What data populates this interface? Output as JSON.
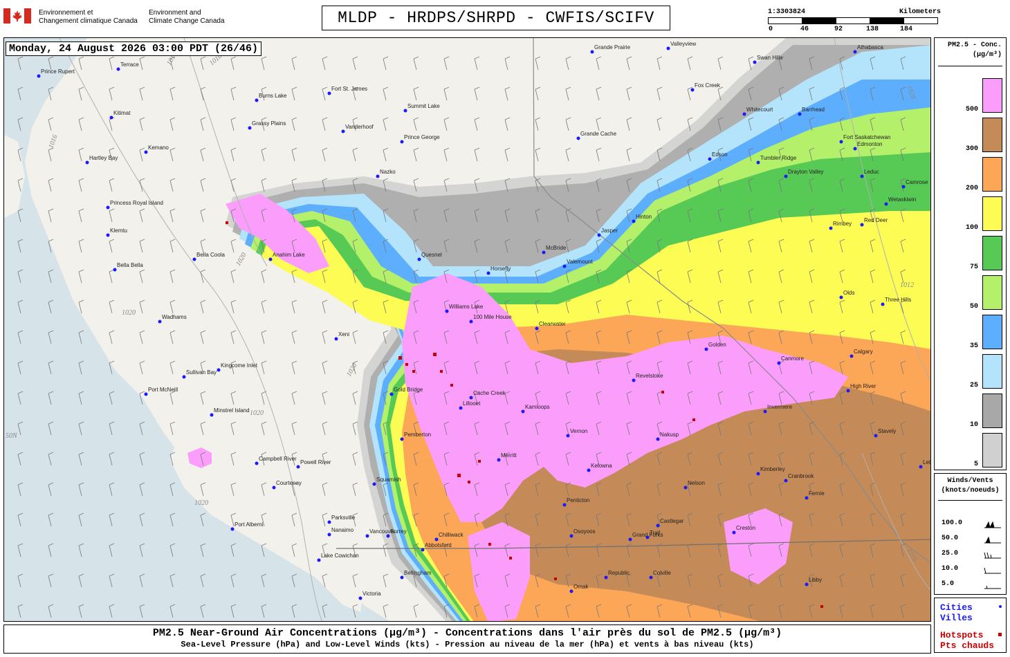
{
  "header": {
    "agency_fr_line1": "Environnement et",
    "agency_fr_line2": "Changement climatique Canada",
    "agency_en_line1": "Environment and",
    "agency_en_line2": "Climate Change Canada",
    "title": "MLDP - HRDPS/SHRPD - CWFIS/SCIFV"
  },
  "scale": {
    "ratio": "1:3303824",
    "unit_label": "Kilometers",
    "ticks": [
      "0",
      "46",
      "92",
      "138",
      "184"
    ]
  },
  "map": {
    "timestamp": "Monday, 24 August 2026 03:00 PDT (26/46)",
    "colors": {
      "water": "#d6e4ea",
      "land": "#f2f1ec",
      "city_dot": "#1a1aff",
      "hotspot": "#cc0000"
    },
    "isobar_labels": [
      "1016",
      "1016",
      "1016",
      "1020",
      "1020",
      "1020",
      "1020",
      "1020",
      "1012",
      "1016",
      "1028"
    ],
    "lat_label": "50N",
    "cities": [
      {
        "name": "Prince Rupert"
      },
      {
        "name": "Terrace"
      },
      {
        "name": "Kitimat"
      },
      {
        "name": "Hartley Bay"
      },
      {
        "name": "Kemano"
      },
      {
        "name": "Princess Royal Island"
      },
      {
        "name": "Klemtu"
      },
      {
        "name": "Bella Bella"
      },
      {
        "name": "Bella Coola"
      },
      {
        "name": "Anahim Lake"
      },
      {
        "name": "Wadhams"
      },
      {
        "name": "Sullivan Bay"
      },
      {
        "name": "Kingcome Inlet"
      },
      {
        "name": "Port McNeill"
      },
      {
        "name": "Minstrel Island"
      },
      {
        "name": "Campbell River"
      },
      {
        "name": "Powell River"
      },
      {
        "name": "Courtenay"
      },
      {
        "name": "Port Alberni"
      },
      {
        "name": "Parksville"
      },
      {
        "name": "Nanaimo"
      },
      {
        "name": "Lake Cowichan"
      },
      {
        "name": "Victoria"
      },
      {
        "name": "Squamish"
      },
      {
        "name": "Vancouver"
      },
      {
        "name": "Surrey"
      },
      {
        "name": "Abbotsford"
      },
      {
        "name": "Chilliwack"
      },
      {
        "name": "Bellingham"
      },
      {
        "name": "Burns Lake"
      },
      {
        "name": "Grassy Plains"
      },
      {
        "name": "Fort St. James"
      },
      {
        "name": "Vanderhoof"
      },
      {
        "name": "Prince George"
      },
      {
        "name": "Summit Lake"
      },
      {
        "name": "Grande Cache"
      },
      {
        "name": "Grande Prairie"
      },
      {
        "name": "Valleyview"
      },
      {
        "name": "Fox Creek"
      },
      {
        "name": "Swan Hills"
      },
      {
        "name": "Whitecourt"
      },
      {
        "name": "Edson"
      },
      {
        "name": "Drayton Valley"
      },
      {
        "name": "Barrhead"
      },
      {
        "name": "Fort Saskatchewan"
      },
      {
        "name": "Edmonton"
      },
      {
        "name": "Leduc"
      },
      {
        "name": "Wetaskiwin"
      },
      {
        "name": "Camrose"
      },
      {
        "name": "Rimbey"
      },
      {
        "name": "Red Deer"
      },
      {
        "name": "Olds"
      },
      {
        "name": "Three Hills"
      },
      {
        "name": "Calgary"
      },
      {
        "name": "Canmore"
      },
      {
        "name": "High River"
      },
      {
        "name": "Stavely"
      },
      {
        "name": "Lethbridge"
      },
      {
        "name": "Fernie"
      },
      {
        "name": "Cranbrook"
      },
      {
        "name": "Kimberley"
      },
      {
        "name": "Invermere"
      },
      {
        "name": "Golden"
      },
      {
        "name": "Revelstoke"
      },
      {
        "name": "Nakusp"
      },
      {
        "name": "Nelson"
      },
      {
        "name": "Castlegar"
      },
      {
        "name": "Trail"
      },
      {
        "name": "Creston"
      },
      {
        "name": "Grand Forks"
      },
      {
        "name": "Osoyoos"
      },
      {
        "name": "Penticton"
      },
      {
        "name": "Kelowna"
      },
      {
        "name": "Vernon"
      },
      {
        "name": "Kamloops"
      },
      {
        "name": "Merritt"
      },
      {
        "name": "Cache Creek"
      },
      {
        "name": "Lillooet"
      },
      {
        "name": "Gold Bridge"
      },
      {
        "name": "Pemberton"
      },
      {
        "name": "100 Mile House"
      },
      {
        "name": "Williams Lake"
      },
      {
        "name": "Clearwater"
      },
      {
        "name": "Horsefly"
      },
      {
        "name": "Quesnel"
      },
      {
        "name": "Nazko"
      },
      {
        "name": "Xeni"
      },
      {
        "name": "Hinton"
      },
      {
        "name": "Jasper"
      },
      {
        "name": "Valemount"
      },
      {
        "name": "McBride"
      },
      {
        "name": "Tumbler Ridge"
      },
      {
        "name": "Omak"
      },
      {
        "name": "Republic"
      },
      {
        "name": "Colville"
      },
      {
        "name": "Libby"
      },
      {
        "name": "Athabasca"
      }
    ]
  },
  "legend_pm": {
    "title_line1": "PM2.5 - Conc.",
    "title_line2": "(μg/m³)",
    "bins": [
      {
        "label": "500",
        "color": "#fb9dfb"
      },
      {
        "label": "300",
        "color": "#c48a57"
      },
      {
        "label": "200",
        "color": "#fca657"
      },
      {
        "label": "100",
        "color": "#fcfc55"
      },
      {
        "label": "75",
        "color": "#57c955"
      },
      {
        "label": "50",
        "color": "#b4f06a"
      },
      {
        "label": "35",
        "color": "#5daefc"
      },
      {
        "label": "25",
        "color": "#b4e4fc"
      },
      {
        "label": "10",
        "color": "#a8a8a8"
      },
      {
        "label": "5",
        "color": "#d0d0d0"
      }
    ]
  },
  "legend_wind": {
    "title_line1": "Winds/Vents",
    "title_line2": "(knots/noeuds)",
    "rows": [
      {
        "label": "100.0",
        "barb": "two-pennants"
      },
      {
        "label": "50.0",
        "barb": "pennant"
      },
      {
        "label": "25.0",
        "barb": "two-half-barbs"
      },
      {
        "label": "10.0",
        "barb": "full-barb"
      },
      {
        "label": "5.0",
        "barb": "half-barb"
      }
    ]
  },
  "legend_points": {
    "cities_fr": "Cities",
    "cities_en": "Villes",
    "hotspots_en": "Hotspots",
    "hotspots_fr": "Pts chauds"
  },
  "caption": {
    "line1": "PM2.5 Near-Ground Air Concentrations (μg/m³) - Concentrations dans l'air près du sol de PM2.5 (μg/m³)",
    "line2": "Sea-Level Pressure (hPa) and Low-Level Winds (kts) - Pression au niveau de la mer (hPa) et vents à bas niveau (kts)"
  }
}
